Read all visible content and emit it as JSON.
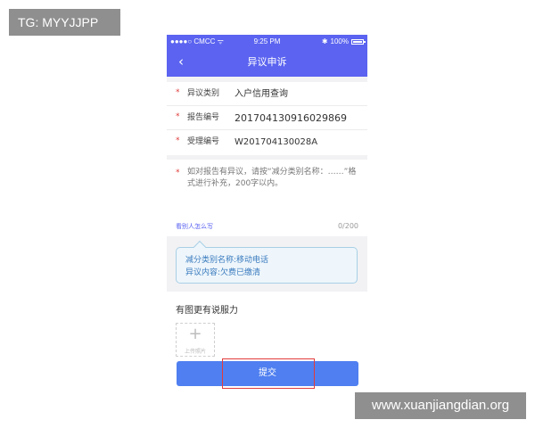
{
  "watermarks": {
    "top_left": "TG: MYYJJPP",
    "bottom_right": "www.xuanjiangdian.org"
  },
  "status_bar": {
    "carrier": "●●●●○ CMCC ᯤ",
    "time": "9:25 PM",
    "bluetooth": "✱",
    "battery": "100%"
  },
  "nav": {
    "title": "异议申诉",
    "back_icon": "chevron-left-icon"
  },
  "info_rows": [
    {
      "label": "异议类别",
      "value": "入户信用查询"
    },
    {
      "label": "报告编号",
      "value": "20170413091602986​9"
    },
    {
      "label": "受理编号",
      "value": "W201704130028A"
    }
  ],
  "memo": {
    "placeholder": "如对报告有异议，请按“减分类别名称：……”格式进行补充，200字以内。",
    "link": "看别人怎么写",
    "count": "0/200"
  },
  "tip": {
    "line1": "减分类别名称:移动电话",
    "line2": "异议内容:欠费已缴清"
  },
  "photos": {
    "title": "有图更有说服力",
    "upload_label": "上传照片"
  },
  "submit": {
    "label": "提交"
  },
  "colors": {
    "primary": "#5b63f0",
    "button": "#4f7ff0",
    "required": "#e03a3a",
    "highlight": "#e23b3b"
  }
}
